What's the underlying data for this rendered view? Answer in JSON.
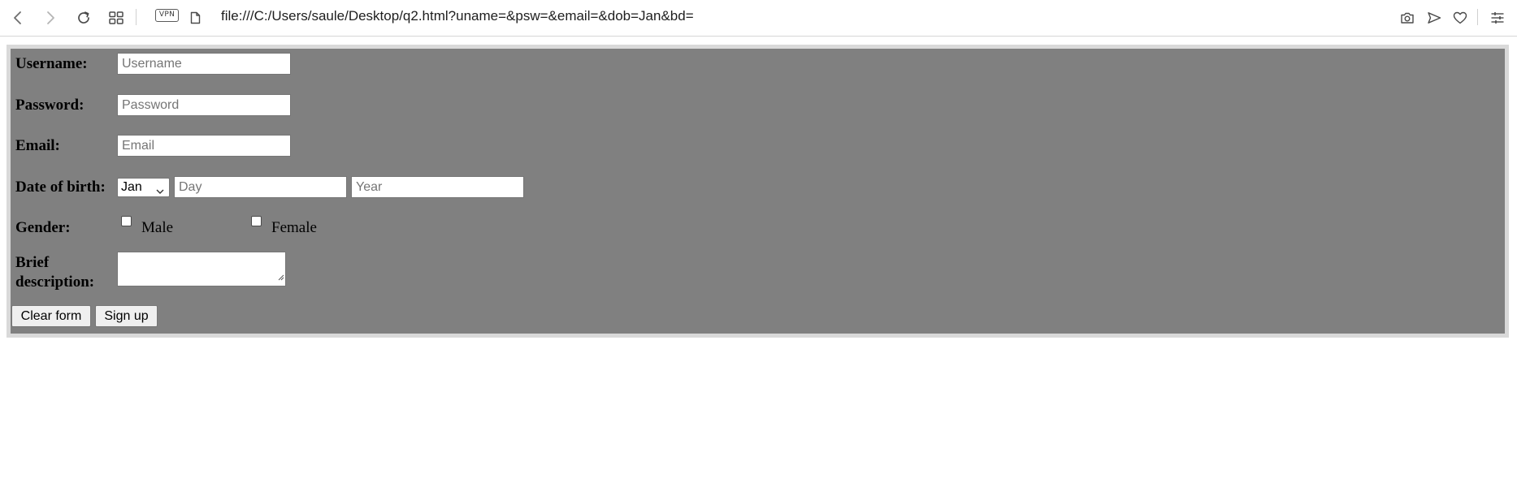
{
  "browser": {
    "vpn_label": "VPN",
    "address_url": "file:///C:/Users/saule/Desktop/q2.html?uname=&psw=&email=&dob=Jan&bd=",
    "icons": [
      "back-icon",
      "forward-icon",
      "reload-icon",
      "tabs-grid-icon",
      "page-icon",
      "camera-icon",
      "send-icon",
      "heart-icon",
      "settings-sliders-icon"
    ]
  },
  "form": {
    "background_color": "#808080",
    "border_color": "#d9d9d9",
    "username": {
      "label": "Username:",
      "placeholder": "Username",
      "value": ""
    },
    "password": {
      "label": "Password:",
      "placeholder": "Password",
      "value": ""
    },
    "email": {
      "label": "Email:",
      "placeholder": "Email",
      "value": ""
    },
    "dob": {
      "label": "Date of birth:",
      "month_selected": "Jan",
      "day_placeholder": "Day",
      "year_placeholder": "Year"
    },
    "gender": {
      "label": "Gender:",
      "options": [
        {
          "label": "Male",
          "checked": false
        },
        {
          "label": "Female",
          "checked": false
        }
      ]
    },
    "description": {
      "label_line1": "Brief",
      "label_line2": "description:",
      "value": ""
    },
    "buttons": {
      "clear": "Clear form",
      "submit": "Sign up"
    }
  }
}
